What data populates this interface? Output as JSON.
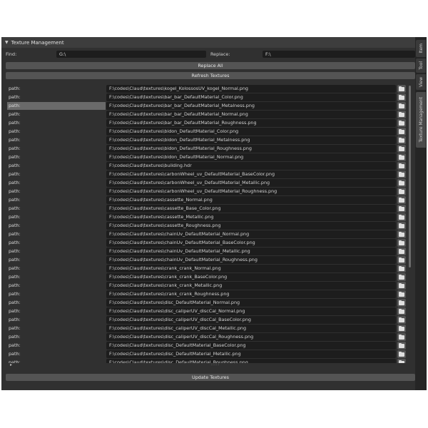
{
  "panel": {
    "title": "Texture Management",
    "find_label": "Find:",
    "find_value": "G:\\",
    "replace_label": "Replace:",
    "replace_value": "F:\\",
    "replace_all_label": "Replace All",
    "refresh_label": "Refresh Textures",
    "update_label": "Update Textures"
  },
  "sidebar": {
    "tabs": [
      {
        "label": "Item"
      },
      {
        "label": "Tool"
      },
      {
        "label": "View"
      },
      {
        "label": "Texture Management"
      }
    ]
  },
  "rows": [
    {
      "label": "path:",
      "value": "F:\\codes\\Claud\\textures\\kogel_KolossosUV_kogel_Normal.png"
    },
    {
      "label": "path:",
      "value": "F:\\codes\\Claud\\textures\\bar_bar_DefaultMaterial_Color.png"
    },
    {
      "label": "path:",
      "value": "F:\\codes\\Claud\\textures\\bar_bar_DefaultMaterial_Metalness.png"
    },
    {
      "label": "path:",
      "value": "F:\\codes\\Claud\\textures\\bar_bar_DefaultMaterial_Normal.png"
    },
    {
      "label": "path:",
      "value": "F:\\codes\\Claud\\textures\\bar_bar_DefaultMaterial_Roughness.png"
    },
    {
      "label": "path:",
      "value": "F:\\codes\\Claud\\textures\\bidon_DefaultMaterial_Color.png"
    },
    {
      "label": "path:",
      "value": "F:\\codes\\Claud\\textures\\bidon_DefaultMaterial_Metalness.png"
    },
    {
      "label": "path:",
      "value": "F:\\codes\\Claud\\textures\\bidon_DefaultMaterial_Roughness.png"
    },
    {
      "label": "path:",
      "value": "F:\\codes\\Claud\\textures\\bidon_DefaultMaterial_Normal.png"
    },
    {
      "label": "path:",
      "value": "F:\\codes\\Claud\\textures\\building.hdr"
    },
    {
      "label": "path:",
      "value": "F:\\codes\\Claud\\textures\\carbonWheel_uv_DefaultMaterial_BaseColor.png"
    },
    {
      "label": "path:",
      "value": "F:\\codes\\Claud\\textures\\carbonWheel_uv_DefaultMaterial_Metallic.png"
    },
    {
      "label": "path:",
      "value": "F:\\codes\\Claud\\textures\\carbonWheel_uv_DefaultMaterial_Roughness.png"
    },
    {
      "label": "path:",
      "value": "F:\\codes\\Claud\\textures\\cassette_Normal.png"
    },
    {
      "label": "path:",
      "value": "F:\\codes\\Claud\\textures\\cassette_Base_Color.png"
    },
    {
      "label": "path:",
      "value": "F:\\codes\\Claud\\textures\\cassette_Metallic.png"
    },
    {
      "label": "path:",
      "value": "F:\\codes\\Claud\\textures\\cassette_Roughness.png"
    },
    {
      "label": "path:",
      "value": "F:\\codes\\Claud\\textures\\chainUv_DefaultMaterial_Normal.png"
    },
    {
      "label": "path:",
      "value": "F:\\codes\\Claud\\textures\\chainUv_DefaultMaterial_BaseColor.png"
    },
    {
      "label": "path:",
      "value": "F:\\codes\\Claud\\textures\\chainUv_DefaultMaterial_Metallic.png"
    },
    {
      "label": "path:",
      "value": "F:\\codes\\Claud\\textures\\chainUv_DefaultMaterial_Roughness.png"
    },
    {
      "label": "path:",
      "value": "F:\\codes\\Claud\\textures\\crank_crank_Normal.png"
    },
    {
      "label": "path:",
      "value": "F:\\codes\\Claud\\textures\\crank_crank_BaseColor.png"
    },
    {
      "label": "path:",
      "value": "F:\\codes\\Claud\\textures\\crank_crank_Metallic.png"
    },
    {
      "label": "path:",
      "value": "F:\\codes\\Claud\\textures\\crank_crank_Roughness.png"
    },
    {
      "label": "path:",
      "value": "F:\\codes\\Claud\\textures\\disc_DefaultMaterial_Normal.png"
    },
    {
      "label": "path:",
      "value": "F:\\codes\\Claud\\textures\\disc_caliperUV_discCal_Normal.png"
    },
    {
      "label": "path:",
      "value": "F:\\codes\\Claud\\textures\\disc_caliperUV_discCal_BaseColor.png"
    },
    {
      "label": "path:",
      "value": "F:\\codes\\Claud\\textures\\disc_caliperUV_discCal_Metallic.png"
    },
    {
      "label": "path:",
      "value": "F:\\codes\\Claud\\textures\\disc_caliperUV_discCal_Roughness.png"
    },
    {
      "label": "path:",
      "value": "F:\\codes\\Claud\\textures\\disc_DefaultMaterial_BaseColor.png"
    },
    {
      "label": "path:",
      "value": "F:\\codes\\Claud\\textures\\disc_DefaultMaterial_Metallic.png"
    },
    {
      "label": "path:",
      "value": "F:\\codes\\Claud\\textures\\disc_DefaultMaterial_Roughness.png"
    }
  ],
  "selected_row_index": 2,
  "colors": {
    "panel_bg": "#303030",
    "header_bg": "#3d3d3d",
    "field_bg": "#1d1d1d",
    "button_bg": "#545454",
    "selected_row_bg": "#6a6a6a"
  },
  "icons": {
    "collapse": "triangle-down-icon",
    "file_browse": "folder-icon",
    "list_expand": "triangle-right-icon",
    "resize_grip": "grip-dots-icon"
  }
}
